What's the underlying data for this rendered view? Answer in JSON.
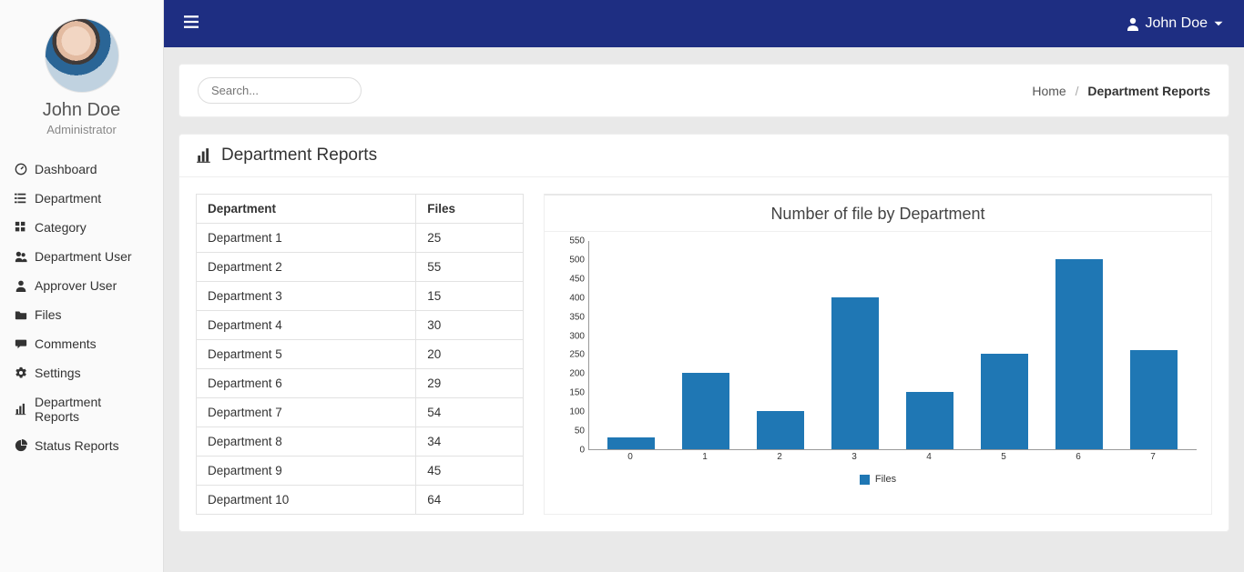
{
  "user": {
    "name": "John Doe",
    "role": "Administrator"
  },
  "header_user": "John Doe",
  "sidebar": {
    "items": [
      {
        "icon": "dashboard-icon",
        "label": "Dashboard"
      },
      {
        "icon": "list-icon",
        "label": "Department"
      },
      {
        "icon": "grid-icon",
        "label": "Category"
      },
      {
        "icon": "users-icon",
        "label": "Department User"
      },
      {
        "icon": "user-icon",
        "label": "Approver User"
      },
      {
        "icon": "folder-icon",
        "label": "Files"
      },
      {
        "icon": "comment-icon",
        "label": "Comments"
      },
      {
        "icon": "gear-icon",
        "label": "Settings"
      },
      {
        "icon": "bar-chart-icon",
        "label": "Department Reports"
      },
      {
        "icon": "pie-chart-icon",
        "label": "Status Reports"
      }
    ]
  },
  "search": {
    "placeholder": "Search..."
  },
  "breadcrumb": {
    "home": "Home",
    "current": "Department Reports"
  },
  "panel": {
    "title": "Department Reports"
  },
  "table": {
    "columns": [
      "Department",
      "Files"
    ],
    "rows": [
      {
        "dept": "Department 1",
        "files": "25"
      },
      {
        "dept": "Department 2",
        "files": "55"
      },
      {
        "dept": "Department 3",
        "files": "15"
      },
      {
        "dept": "Department 4",
        "files": "30"
      },
      {
        "dept": "Department 5",
        "files": "20"
      },
      {
        "dept": "Department 6",
        "files": "29"
      },
      {
        "dept": "Department 7",
        "files": "54"
      },
      {
        "dept": "Department 8",
        "files": "34"
      },
      {
        "dept": "Department 9",
        "files": "45"
      },
      {
        "dept": "Department 10",
        "files": "64"
      }
    ]
  },
  "chart_data": {
    "type": "bar",
    "title": "Number of file by Department",
    "legend": "Files",
    "x": [
      "0",
      "1",
      "2",
      "3",
      "4",
      "5",
      "6",
      "7"
    ],
    "y_ticks": [
      0,
      50,
      100,
      150,
      200,
      250,
      300,
      350,
      400,
      450,
      500,
      550
    ],
    "ylim": [
      0,
      550
    ],
    "values": [
      30,
      200,
      100,
      400,
      150,
      250,
      500,
      260
    ]
  }
}
